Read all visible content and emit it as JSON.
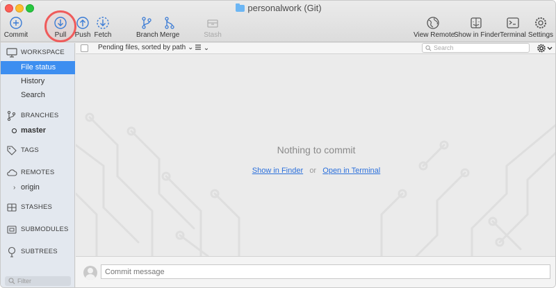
{
  "window": {
    "title": "personalwork (Git)"
  },
  "toolbar": {
    "commit": "Commit",
    "pull": "Pull",
    "push": "Push",
    "fetch": "Fetch",
    "branch": "Branch",
    "merge": "Merge",
    "stash": "Stash",
    "view_remote": "View Remote",
    "show_in_finder": "Show in Finder",
    "terminal": "Terminal",
    "settings": "Settings"
  },
  "sidebar": {
    "workspace": "WORKSPACE",
    "workspace_items": [
      "File status",
      "History",
      "Search"
    ],
    "branches": "BRANCHES",
    "current_branch": "master",
    "tags": "TAGS",
    "remotes": "REMOTES",
    "remote_items": [
      "origin"
    ],
    "stashes": "STASHES",
    "submodules": "SUBMODULES",
    "subtrees": "SUBTREES",
    "filter_placeholder": "Filter"
  },
  "main": {
    "sort_label": "Pending files, sorted by path",
    "search_placeholder": "Search",
    "empty_title": "Nothing to commit",
    "link_finder": "Show in Finder",
    "link_or": "or",
    "link_terminal": "Open in Terminal",
    "commit_placeholder": "Commit message"
  },
  "colors": {
    "accent": "#3d8ef0",
    "link": "#2a6fdb",
    "highlight_circle": "#ef5b5b"
  }
}
